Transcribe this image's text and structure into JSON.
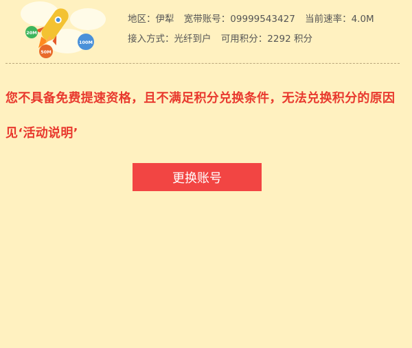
{
  "account_info": {
    "region_label": "地区：伊犁",
    "account_label": "宽带账号：09999543427",
    "speed_label": "当前速率：4.0M",
    "access_label": "接入方式：光纤到户",
    "points_label": "可用积分：2292 积分"
  },
  "illustration": {
    "badge_20": "20M",
    "badge_50": "50M",
    "badge_100": "100M",
    "colors": {
      "badge_20": "#3cb55d",
      "badge_50": "#e86a2a",
      "badge_100": "#4a90d9",
      "rocket": "#f3c232"
    }
  },
  "notice": {
    "text": "您不具备免费提速资格，且不满足积分兑换条件，无法兑换积分的原因见‘活动说明’"
  },
  "button": {
    "label": "更换账号",
    "color": "#f24543"
  }
}
